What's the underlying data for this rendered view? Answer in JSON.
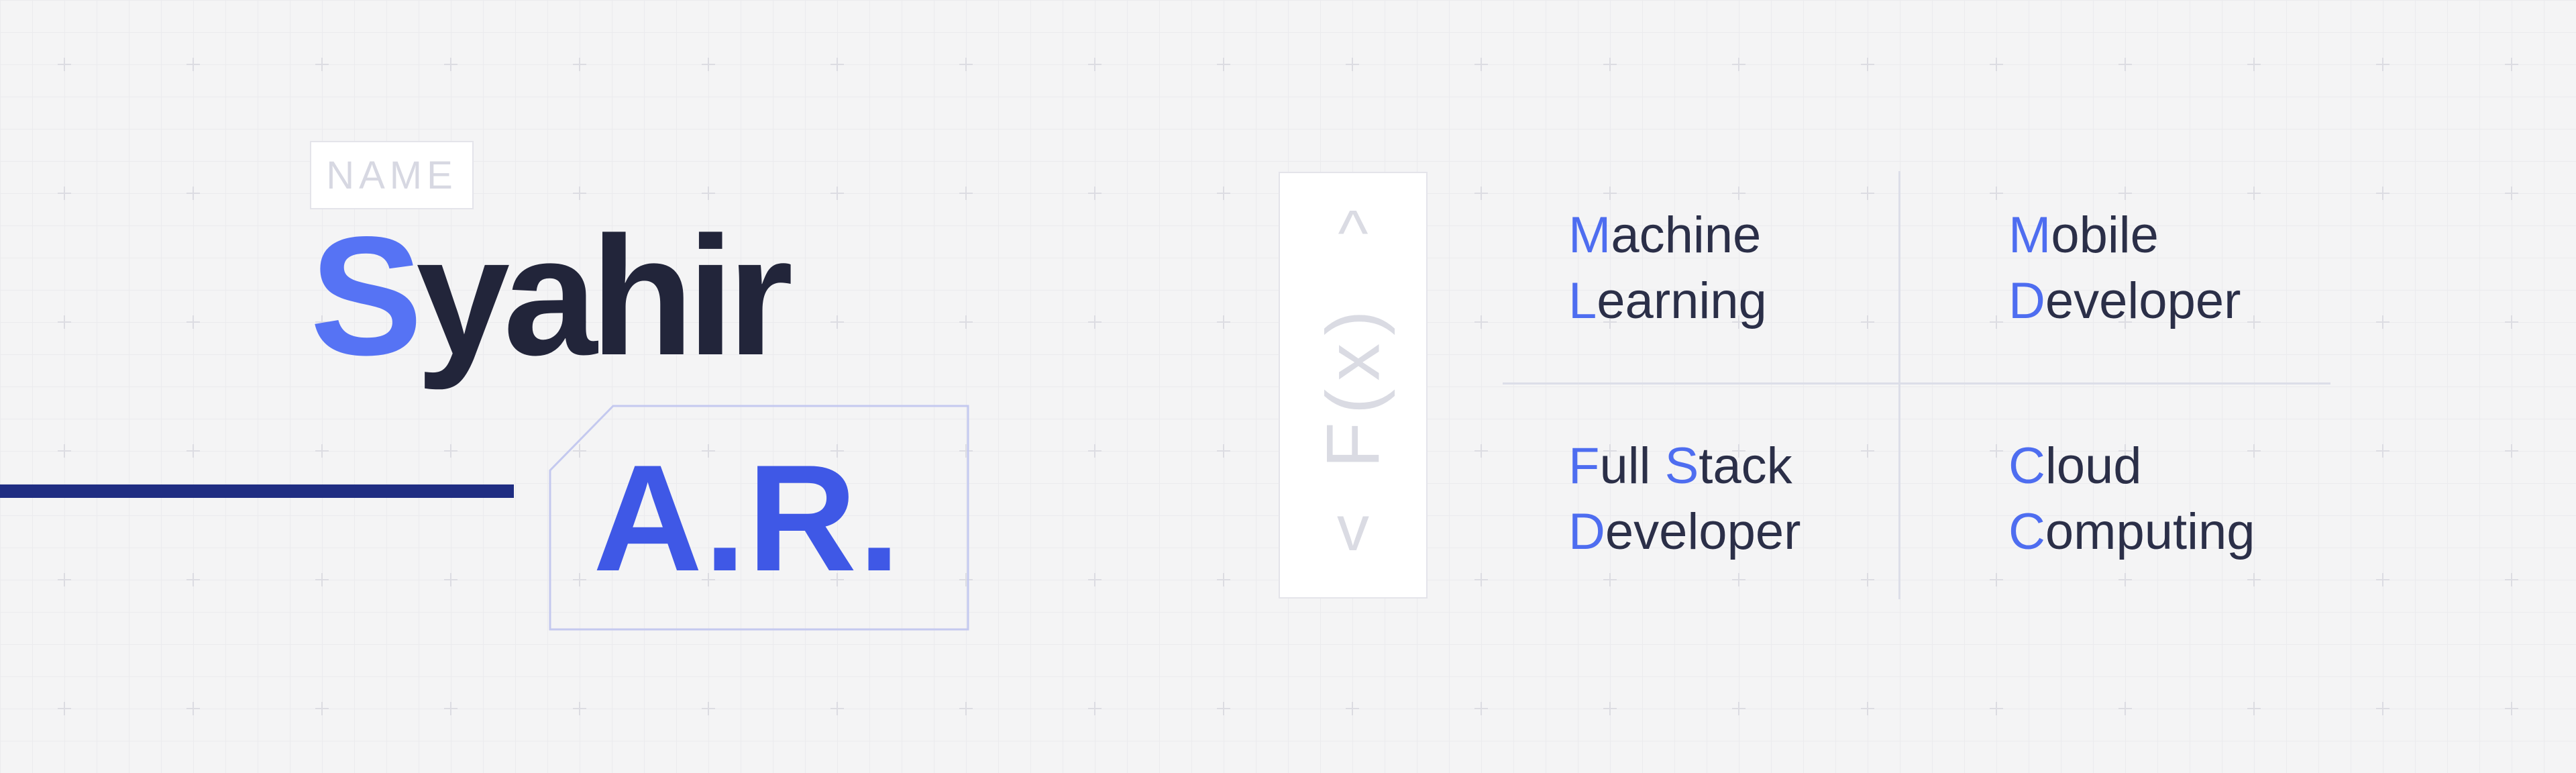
{
  "name_label": "NAME",
  "first_name": {
    "initial": "S",
    "rest": "yahir"
  },
  "initials": "A.R.",
  "fx": {
    "up_symbol": "^",
    "label": "F(x)",
    "down_symbol": "v"
  },
  "skills": [
    {
      "lines": [
        {
          "first": "M",
          "rest": "achine"
        },
        {
          "first": "L",
          "rest": "earning"
        }
      ]
    },
    {
      "lines": [
        {
          "first": "M",
          "rest": "obile"
        },
        {
          "first": "D",
          "rest": "eveloper"
        }
      ]
    },
    {
      "lines": [
        {
          "first": "F",
          "rest": "ull ",
          "first2": "S",
          "rest2": "tack"
        },
        {
          "first": "D",
          "rest": "eveloper"
        }
      ]
    },
    {
      "lines": [
        {
          "first": "C",
          "rest": "loud"
        },
        {
          "first": "C",
          "rest": "omputing"
        }
      ]
    }
  ],
  "colors": {
    "accent_blue": "#5673f4",
    "dark_text": "#22253a",
    "navy_bar": "#1f2d82",
    "background": "#f4f4f5"
  }
}
